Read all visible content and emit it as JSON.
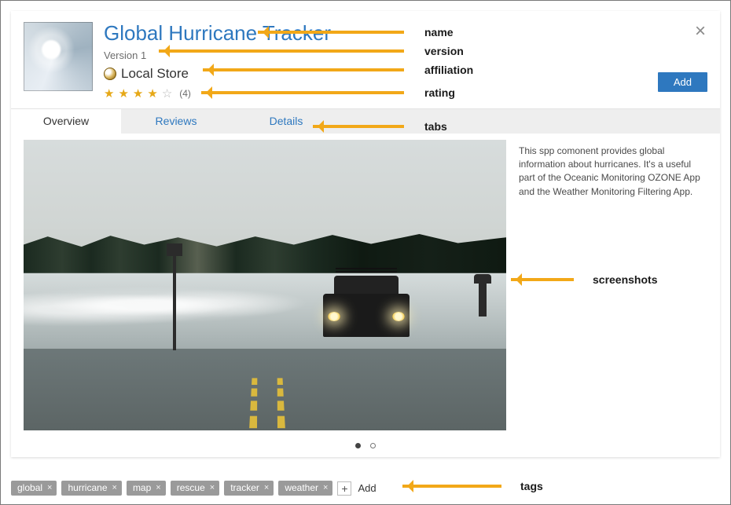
{
  "header": {
    "title": "Global Hurricane Tracker",
    "version": "Version 1",
    "affiliation": "Local Store",
    "rating_count": "(4)",
    "add_label": "Add"
  },
  "tabs": {
    "overview": "Overview",
    "reviews": "Reviews",
    "details": "Details"
  },
  "overview": {
    "description": "This spp comonent provides global information about hurricanes. It's a useful part of the Oceanic Monitoring OZONE App and the Weather Monitoring Filtering App."
  },
  "tags": {
    "items": [
      "global",
      "hurricane",
      "map",
      "rescue",
      "tracker",
      "weather"
    ],
    "add_label": "Add"
  },
  "annotations": {
    "name": "name",
    "version": "version",
    "affiliation": "affiliation",
    "rating": "rating",
    "tabs": "tabs",
    "screenshots": "screenshots",
    "tags": "tags"
  }
}
